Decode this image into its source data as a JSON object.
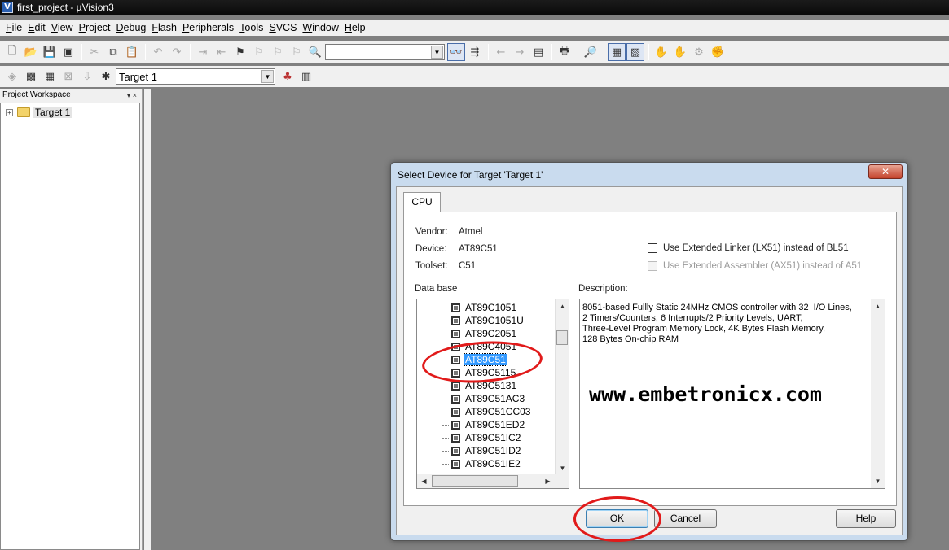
{
  "window": {
    "title": "first_project - µVision3",
    "icon_glyph": "V"
  },
  "menu": [
    {
      "ul": "F",
      "rest": "ile"
    },
    {
      "ul": "E",
      "rest": "dit"
    },
    {
      "ul": "V",
      "rest": "iew"
    },
    {
      "ul": "P",
      "rest": "roject"
    },
    {
      "ul": "D",
      "rest": "ebug"
    },
    {
      "ul": "F",
      "rest": "lash"
    },
    {
      "ul": "P",
      "rest": "eripherals"
    },
    {
      "ul": "T",
      "rest": "ools"
    },
    {
      "ul": "S",
      "rest": "VCS"
    },
    {
      "ul": "W",
      "rest": "indow"
    },
    {
      "ul": "H",
      "rest": "elp"
    }
  ],
  "toolbar": {
    "find_combo_value": "",
    "target_combo_value": "Target 1"
  },
  "workspace": {
    "header": "Project Workspace",
    "header_controls": "▾ ×",
    "tree_root": "Target 1",
    "expander": "+"
  },
  "dialog": {
    "title": "Select Device for Target 'Target 1'",
    "close_glyph": "✕",
    "tab": "CPU",
    "vendor_label": "Vendor:",
    "vendor_value": "Atmel",
    "device_label": "Device:",
    "device_value": "AT89C51",
    "toolset_label": "Toolset:",
    "toolset_value": "C51",
    "use_lx51": "Use Extended Linker (LX51) instead of BL51",
    "use_ax51": "Use Extended Assembler (AX51) instead of A51",
    "database_label": "Data base",
    "description_label": "Description:",
    "description": "8051-based Fullly Static 24MHz CMOS controller with 32  I/O Lines,\n2 Timers/Counters, 6 Interrupts/2 Priority Levels, UART,\nThree-Level Program Memory Lock, 4K Bytes Flash Memory,\n128 Bytes On-chip RAM",
    "devices": [
      "AT89C1051",
      "AT89C1051U",
      "AT89C2051",
      "AT89C4051",
      "AT89C51",
      "AT89C5115",
      "AT89C5131",
      "AT89C51AC3",
      "AT89C51CC03",
      "AT89C51ED2",
      "AT89C51IC2",
      "AT89C51ID2",
      "AT89C51IE2"
    ],
    "selected_device": "AT89C51",
    "ok_label": "OK",
    "cancel_label": "Cancel",
    "help_label": "Help"
  },
  "watermark": "www.embetronicx.com",
  "annotation_color": "#e11a1a"
}
